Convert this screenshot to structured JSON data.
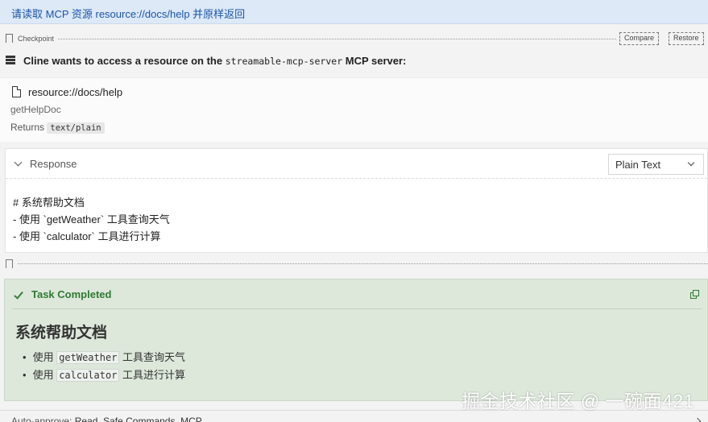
{
  "user_message": "请读取 MCP 资源 resource://docs/help 并原样返回",
  "checkpoint": {
    "label": "Checkpoint",
    "compare_label": "Compare",
    "restore_label": "Restore"
  },
  "access": {
    "prefix": "Cline wants to access a resource on the",
    "server": "streamable-mcp-server",
    "suffix": "MCP server:"
  },
  "resource": {
    "uri": "resource://docs/help",
    "name": "getHelpDoc",
    "returns_label": "Returns",
    "mime_type": "text/plain"
  },
  "response": {
    "label": "Response",
    "format": "Plain Text",
    "lines": [
      "# 系统帮助文档",
      "- 使用 `getWeather` 工具查询天气",
      "- 使用 `calculator` 工具进行计算"
    ]
  },
  "task": {
    "title": "Task Completed",
    "heading": "系统帮助文档",
    "items": [
      {
        "pre": "使用 ",
        "code": "getWeather",
        "post": " 工具查询天气"
      },
      {
        "pre": "使用 ",
        "code": "calculator",
        "post": " 工具进行计算"
      }
    ]
  },
  "auto_approve": {
    "label": "Auto-approve:",
    "value": "Read, Safe Commands, MCP"
  },
  "watermark": "掘金技术社区 @ 一碗面421",
  "colors": {
    "accent_blue": "#1a55a8",
    "success_green": "#2f7a32",
    "task_bg": "#dde8db"
  }
}
